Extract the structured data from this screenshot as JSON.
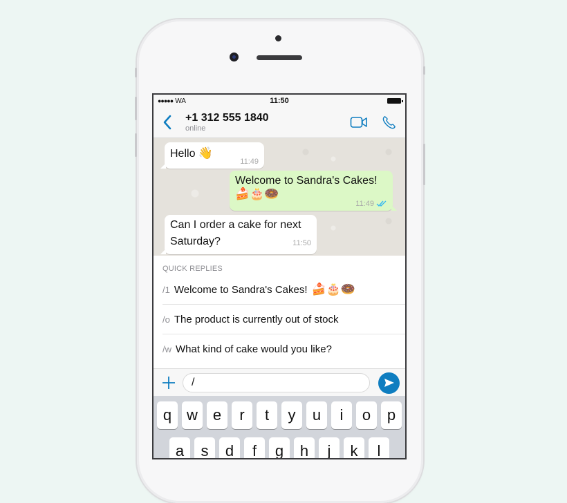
{
  "status_bar": {
    "carrier_dots": "●●●●●",
    "carrier": "WA",
    "time": "11:50",
    "battery_icon": "battery-full"
  },
  "header": {
    "back_icon": "chevron-left",
    "contact_name": "+1 312 555 1840",
    "contact_status": "online",
    "video_call_icon": "video-camera",
    "voice_call_icon": "phone-handset"
  },
  "messages": [
    {
      "direction": "incoming",
      "text": "Hello",
      "emoji": "👋",
      "time": "11:49"
    },
    {
      "direction": "outgoing",
      "text": "Welcome to Sandra's Cakes!",
      "emoji": "🍰🎂🍩",
      "time": "11:49",
      "receipt": "read-double-check"
    },
    {
      "direction": "incoming",
      "text_line1": "Can I order a cake for next",
      "text_line2": "Saturday?",
      "time": "11:50"
    }
  ],
  "quick_replies": {
    "title": "QUICK REPLIES",
    "items": [
      {
        "shortcut": "/1",
        "text": "Welcome to Sandra's Cakes!",
        "emoji": "🍰🎂🍩"
      },
      {
        "shortcut": "/o",
        "text": "The product is currently out of stock"
      },
      {
        "shortcut": "/w",
        "text": "What kind of cake would you like?"
      }
    ]
  },
  "composer": {
    "attach_icon": "plus",
    "value": "/",
    "send_icon": "send-arrow"
  },
  "keyboard": {
    "row1": [
      "q",
      "w",
      "e",
      "r",
      "t",
      "y",
      "u",
      "i",
      "o",
      "p"
    ],
    "row2": [
      "a",
      "s",
      "d",
      "f",
      "g",
      "h",
      "j",
      "k",
      "l"
    ]
  },
  "colors": {
    "accent": "#0e7dc0",
    "outgoing_bubble": "#dcf8c6",
    "chat_bg": "#e5e2dc",
    "page_bg": "#edf6f3"
  }
}
